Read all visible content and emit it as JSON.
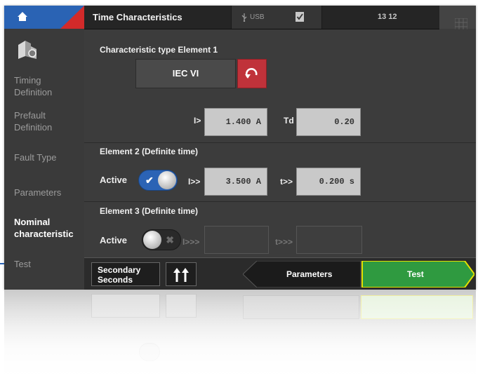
{
  "app": {
    "title": "Time Characteristics",
    "usb_label": "USB",
    "clock": "13 12"
  },
  "sidebar": {
    "items": [
      {
        "label": "Timing Definition",
        "active": false
      },
      {
        "label": "Prefault Definition",
        "active": false
      },
      {
        "label": "Fault Type",
        "active": false
      },
      {
        "label": "Parameters",
        "active": false
      },
      {
        "label": "Nominal characteristic",
        "active": true
      },
      {
        "label": "Test",
        "active": false
      }
    ]
  },
  "element1": {
    "title": "Characteristic type Element 1",
    "type_value": "IEC VI",
    "i_label": "I>",
    "i_value": "1.400 A",
    "td_label": "Td",
    "td_value": "0.20"
  },
  "element2": {
    "title": "Element 2 (Definite time)",
    "active_label": "Active",
    "active": true,
    "i_label": "I>>",
    "i_value": "3.500 A",
    "t_label": "t>>",
    "t_value": "0.200 s"
  },
  "element3": {
    "title": "Element 3 (Definite time)",
    "active_label": "Active",
    "active": false,
    "i_label": "I>>>",
    "t_label": "t>>>"
  },
  "bottombar": {
    "units_line1": "Secondary",
    "units_line2": "Seconds",
    "back_label": "Parameters",
    "next_label": "Test"
  },
  "colors": {
    "accent_blue": "#2a63b4",
    "warning_red": "#c0323a",
    "next_green": "#2f9a40",
    "next_border": "#e3e000"
  },
  "icons": [
    "home-icon",
    "settings-logo-icon",
    "usb-icon",
    "checklist-icon",
    "grid-icon",
    "undo-icon",
    "check-icon",
    "x-icon",
    "up-arrows-icon"
  ]
}
